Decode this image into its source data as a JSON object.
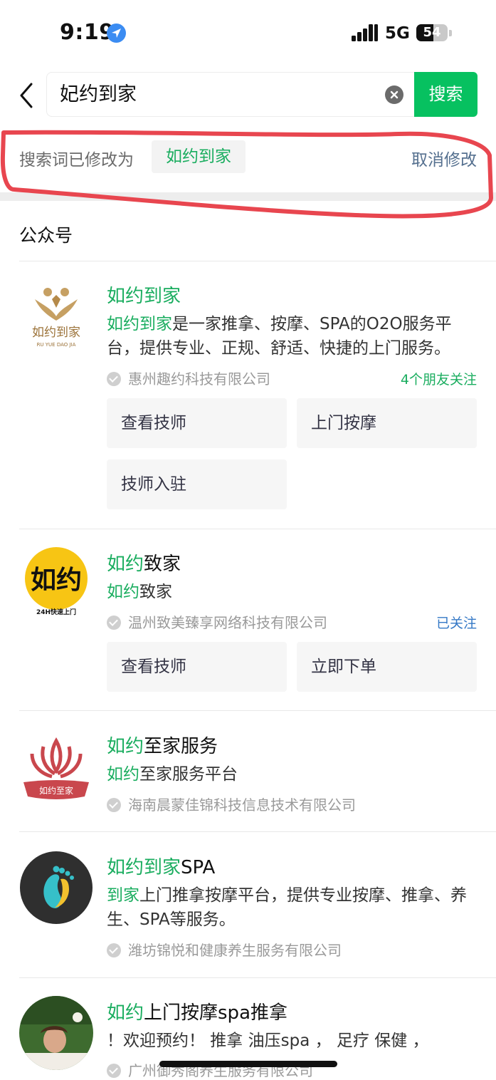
{
  "status_bar": {
    "time": "9:19",
    "network": "5G",
    "battery": "54"
  },
  "search": {
    "query": "妃约到家",
    "button_label": "搜索"
  },
  "correction": {
    "label": "搜索词已修改为",
    "corrected_term": "如约到家",
    "cancel_label": "取消修改"
  },
  "section": {
    "title": "公众号"
  },
  "results": [
    {
      "title_highlight": "如约到家",
      "title_rest": "",
      "desc_highlight": "如约到家",
      "desc_rest": "是一家推拿、按摩、SPA的O2O服务平台，提供专业、正规、舒适、快捷的上门服务。",
      "company": "惠州趣约科技有限公司",
      "friends": "4个朋友关注",
      "services": [
        "查看技师",
        "上门按摩",
        "技师入驻"
      ],
      "logo_text": "如约到家",
      "logo_sub": "RU YUE DAO JIA"
    },
    {
      "title_highlight": "如约",
      "title_rest": "致家",
      "desc_highlight": "如约",
      "desc_rest": "致家",
      "company": "温州致美臻享网络科技有限公司",
      "followed": "已关注",
      "services": [
        "查看技师",
        "立即下单"
      ],
      "logo_text": "如约",
      "logo_sub": "24H快速上门"
    },
    {
      "title_highlight": "如约",
      "title_rest": "至家服务",
      "desc_highlight": "如约",
      "desc_rest": "至家服务平台",
      "company": "海南晨蒙佳锦科技信息技术有限公司",
      "logo_text": "如约至家"
    },
    {
      "title_highlight": "如约到家",
      "title_rest": "SPA",
      "desc_highlight": "到家",
      "desc_rest": "上门推拿按摩平台，提供专业按摩、推拿、养生、SPA等服务。",
      "company": "潍坊锦悦和健康养生服务有限公司"
    },
    {
      "title_highlight": "如约",
      "title_rest": "上门按摩spa推拿",
      "desc_highlight": "",
      "desc_rest": "！欢迎预约！ 推拿 油压spa ， 足疗 保健 ，",
      "company": "广州御秀阁养生服务有限公司"
    }
  ],
  "colors": {
    "accent_green": "#07c160",
    "highlight_green": "#1aad5f",
    "link_blue": "#3478c6",
    "annotation_red": "#e8464f"
  }
}
